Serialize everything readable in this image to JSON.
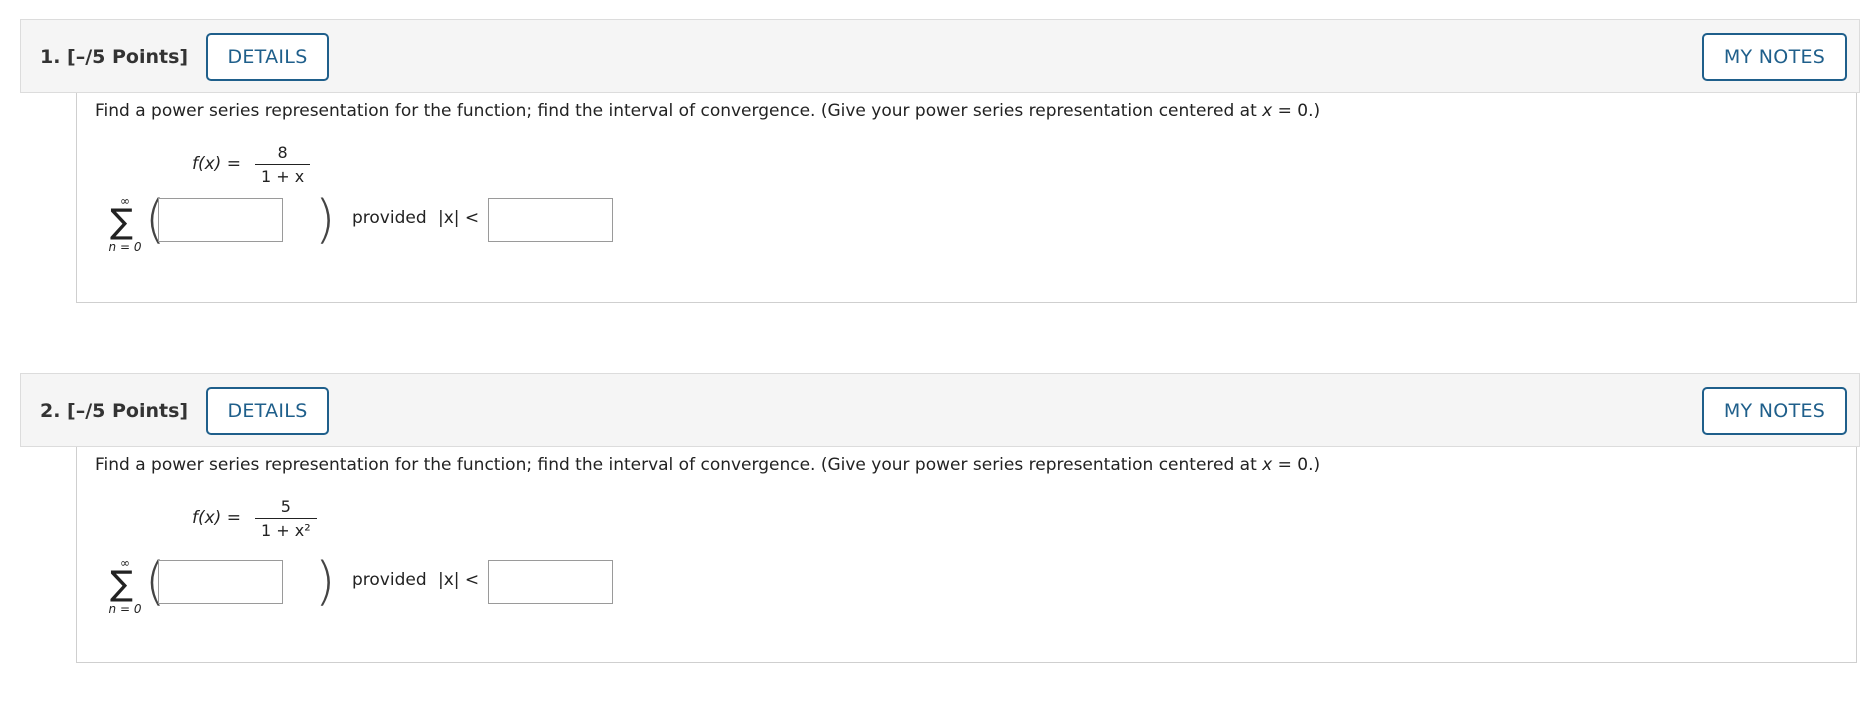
{
  "questions": [
    {
      "number_label": "1. [–/5 Points]",
      "details_label": "DETAILS",
      "notes_label": "MY NOTES",
      "prompt_before": "Find a power series representation for the function; find the interval of convergence. (Give your power series representation centered at ",
      "prompt_var": "x",
      "prompt_after": " = 0.)",
      "function_lhs": "f(x) =",
      "numerator": "8",
      "denominator": "1 + x",
      "sum_upper": "∞",
      "sum_symbol": "∑",
      "sum_lower": "n = 0",
      "series_value": "",
      "provided_label": "provided",
      "abs_label": "|x| <",
      "radius_value": ""
    },
    {
      "number_label": "2. [–/5 Points]",
      "details_label": "DETAILS",
      "notes_label": "MY NOTES",
      "prompt_before": "Find a power series representation for the function; find the interval of convergence. (Give your power series representation centered at ",
      "prompt_var": "x",
      "prompt_after": " = 0.)",
      "function_lhs": "f(x) =",
      "numerator": "5",
      "denominator": "1 + x²",
      "sum_upper": "∞",
      "sum_symbol": "∑",
      "sum_lower": "n = 0",
      "series_value": "",
      "provided_label": "provided",
      "abs_label": "|x| <",
      "radius_value": ""
    }
  ],
  "colors": {
    "button_border": "#1f5f8b",
    "header_bg": "#f5f5f5"
  }
}
